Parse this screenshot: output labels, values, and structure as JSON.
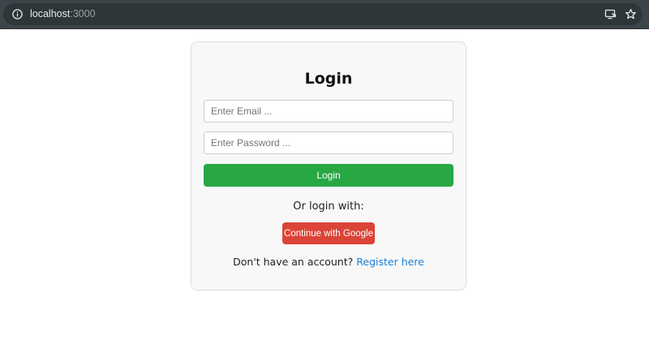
{
  "browser": {
    "url_host": "localhost",
    "url_port": ":3000",
    "icons": {
      "site_info": "info-circle-icon",
      "install": "install-app-icon",
      "bookmark": "star-icon"
    }
  },
  "login": {
    "title": "Login",
    "email_placeholder": "Enter Email ...",
    "password_placeholder": "Enter Password ...",
    "login_label": "Login",
    "login_color": "#28a745",
    "alt_text": "Or login with:",
    "google_label": "Continue with Google",
    "google_color": "#db4437",
    "register_prompt": "Don't have an account?",
    "register_link": "Register here",
    "link_color": "#1a7fd4"
  }
}
